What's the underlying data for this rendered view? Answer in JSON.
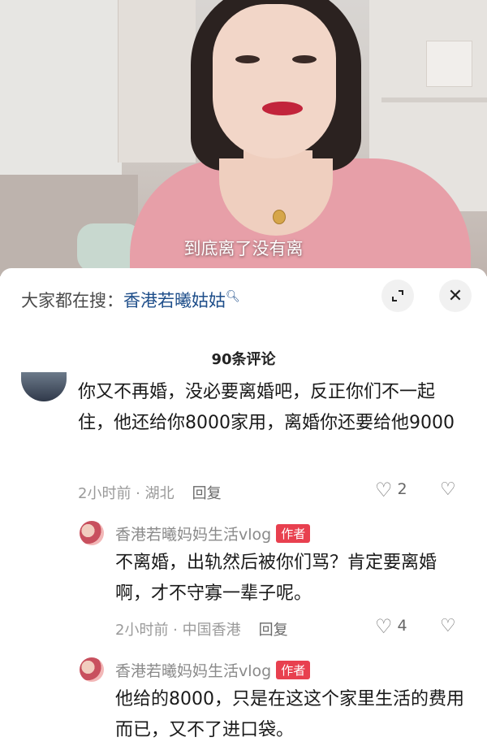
{
  "video": {
    "subtitle": "到底离了没有离"
  },
  "search": {
    "prefix": "大家都在搜：",
    "term": "香港若曦姑姑"
  },
  "comments_header": {
    "count_label": "90条评论"
  },
  "comments": [
    {
      "text": "你又不再婚，没必要离婚吧，反正你们不一起住，他还给你8000家用，离婚你还要给他9000",
      "time_location": "2小时前 · 湖北",
      "reply_label": "回复",
      "likes": "2"
    }
  ],
  "replies": [
    {
      "author": "香港若曦妈妈生活vlog",
      "badge": "作者",
      "text": "不离婚，出轨然后被你们骂？肯定要离婚啊，才不守寡一辈子呢。",
      "time_location": "2小时前 · 中国香港",
      "reply_label": "回复",
      "likes": "4"
    },
    {
      "author": "香港若曦妈妈生活vlog",
      "badge": "作者",
      "text": "他给的8000，只是在这这个家里生活的费用而已，又不了进口袋。"
    }
  ]
}
